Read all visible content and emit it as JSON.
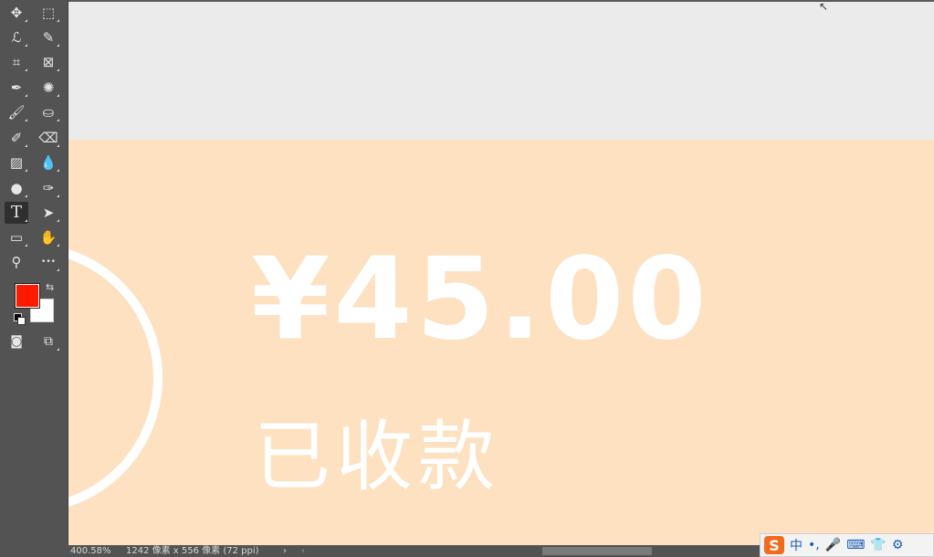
{
  "toolbar": {
    "tools": [
      {
        "name": "move-tool",
        "icon": "move-icon",
        "glyph": "✥"
      },
      {
        "name": "marquee-tool",
        "icon": "marquee-icon",
        "glyph": "⬚"
      },
      {
        "name": "lasso-tool",
        "icon": "lasso-icon",
        "glyph": "ℒ"
      },
      {
        "name": "quick-select-tool",
        "icon": "quick-select-icon",
        "glyph": "✎"
      },
      {
        "name": "crop-tool",
        "icon": "crop-icon",
        "glyph": "⌗"
      },
      {
        "name": "frame-tool",
        "icon": "frame-icon",
        "glyph": "⊠"
      },
      {
        "name": "eyedropper-tool",
        "icon": "eyedropper-icon",
        "glyph": "✒"
      },
      {
        "name": "patch-tool",
        "icon": "spot-healing-icon",
        "glyph": "✺"
      },
      {
        "name": "brush-tool",
        "icon": "brush-icon",
        "glyph": "🖌"
      },
      {
        "name": "stamp-tool",
        "icon": "clone-stamp-icon",
        "glyph": "⛀"
      },
      {
        "name": "history-brush-tool",
        "icon": "history-brush-icon",
        "glyph": "✐"
      },
      {
        "name": "eraser-tool",
        "icon": "eraser-icon",
        "glyph": "⌫"
      },
      {
        "name": "gradient-tool",
        "icon": "gradient-icon",
        "glyph": "▨"
      },
      {
        "name": "blur-tool",
        "icon": "blur-drop-icon",
        "glyph": "💧"
      },
      {
        "name": "dodge-tool",
        "icon": "dodge-icon",
        "glyph": "●"
      },
      {
        "name": "pen-tool",
        "icon": "pen-icon",
        "glyph": "✑"
      },
      {
        "name": "type-tool",
        "icon": "type-icon",
        "glyph": "T"
      },
      {
        "name": "path-select-tool",
        "icon": "path-select-icon",
        "glyph": "➤"
      },
      {
        "name": "rectangle-tool",
        "icon": "rectangle-icon",
        "glyph": "▭"
      },
      {
        "name": "hand-tool",
        "icon": "hand-icon",
        "glyph": "✋"
      },
      {
        "name": "zoom-tool",
        "icon": "zoom-icon",
        "glyph": "⚲"
      },
      {
        "name": "more-tools",
        "icon": "ellipsis-icon",
        "glyph": "•••"
      }
    ],
    "foreground_color": "#ff1a00",
    "background_color": "#ffffff"
  },
  "canvas": {
    "amount": "¥45.00",
    "status": "已收款",
    "canvas_bg": "#ebebeb",
    "peach_color": "#fde1c1"
  },
  "statusbar": {
    "zoom": "400.58%",
    "doc_info": "1242 像素 x 556 像素 (72 ppi)",
    "arrow": "›",
    "scroll_left": "‹"
  },
  "ime": {
    "logo": "S",
    "lang": "中",
    "punct": "•,",
    "mic": "🎤",
    "keyboard": "⌨",
    "skin": "👕",
    "more": "⚙"
  }
}
